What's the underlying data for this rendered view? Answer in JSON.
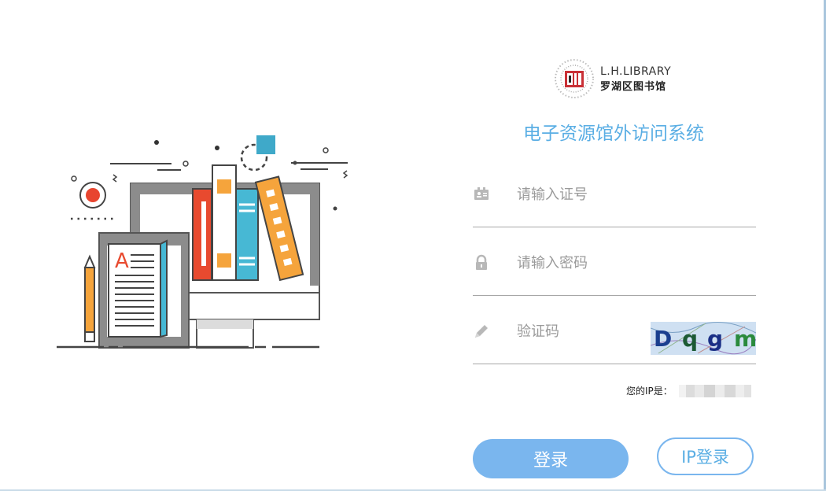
{
  "library": {
    "name_en": "L.H.LIBRARY",
    "name_cn": "罗湖区图书馆",
    "logo_icon": "library-seal-logo"
  },
  "system_title": "电子资源馆外访问系统",
  "form": {
    "card_number": {
      "placeholder": "请输入证号",
      "value": "",
      "icon": "id-card-icon"
    },
    "password": {
      "placeholder": "请输入密码",
      "value": "",
      "icon": "lock-icon"
    },
    "captcha": {
      "placeholder": "验证码",
      "value": "",
      "icon": "pencil-icon",
      "captcha_text": "Dqgm"
    }
  },
  "ip_label": "您的IP是：",
  "buttons": {
    "login": "登录",
    "ip_login": "IP登录"
  },
  "colors": {
    "accent": "#5aaee4",
    "login_button": "#7ab6ee",
    "divider": "#a7a7a7"
  }
}
